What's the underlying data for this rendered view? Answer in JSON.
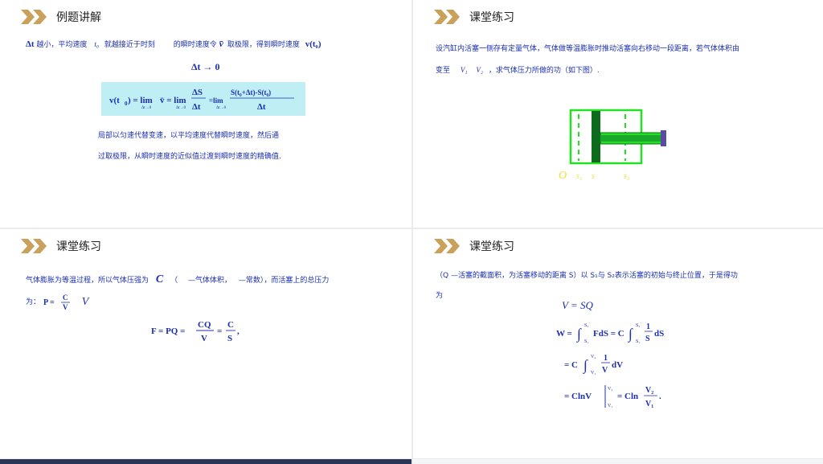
{
  "slides": [
    {
      "title": "例题讲解",
      "line1_a": "Δt",
      "line1_b": " 越小，平均速度",
      "line1_t0": "t₀",
      "line1_c": "就越接近于时刻",
      "line1_d": "的瞬时速度令",
      "line1_vbar": "v̄",
      "line1_e": "取极限，得到瞬时速度",
      "line1_vt0": "v(t₀)",
      "limit_line": "Δt → 0",
      "formula": "v(t₀) = lim v̄ = lim ΔS/Δt = lim [S(t₀+Δt)−S(t₀)]/Δt",
      "para1": "局部以匀速代替变速，以平均速度代替瞬时速度，然后通",
      "para2": "过取极限，从瞬时速度的近似值过渡到瞬时速度的精确值."
    },
    {
      "title": "课堂练习",
      "line1": "设汽缸内活塞一侧存有定量气体，气体做等温膨胀时推动活塞向右移动一段距离，若气体体积由",
      "line2_a": "变至",
      "line2_v1": "V₁",
      "line2_v2": "V₂",
      "line2_b": "，求气体压力所做的功（如下图）.",
      "fig_labels": [
        "O",
        "s₁",
        "s",
        "s₂"
      ]
    },
    {
      "title": "课堂练习",
      "line1_a": "气体膨胀为等温过程，所以气体压强为",
      "line1_C": "C",
      "line1_b": "（",
      "line1_c": "—气体体积，",
      "line1_d": "—常数），而活塞上的总压力",
      "line2_a": "为：",
      "line2_formula": "P = C/V",
      "line2_V": "V",
      "formula": "F = PQ = CQ/V = C/S,"
    },
    {
      "title": "课堂练习",
      "line1": "（Q —活塞的截面积，为活塞移动的距离 S）以 S₁与 S₂表示活塞的初始与终止位置，于是得功",
      "line2": "为",
      "eq1": "V = SQ",
      "eq2": "W = ∫ FdS = C∫ (1/S) dS",
      "eq3": "= C∫ (1/V) dV",
      "eq4": "= ClnV | = Cln V₂/V₁ ."
    }
  ],
  "colors": {
    "text_blue": "#1c2fb0",
    "title_black": "#222222",
    "chevron_gold": "#c9a15a",
    "formula_bg": "#bfeff5",
    "cylinder_green": "#22e022",
    "piston_dark": "#0d6b1c",
    "rod_purple": "#5a4ba0",
    "label_yellow": "#e8e23a"
  },
  "icons": [
    "double-chevron-icon"
  ]
}
